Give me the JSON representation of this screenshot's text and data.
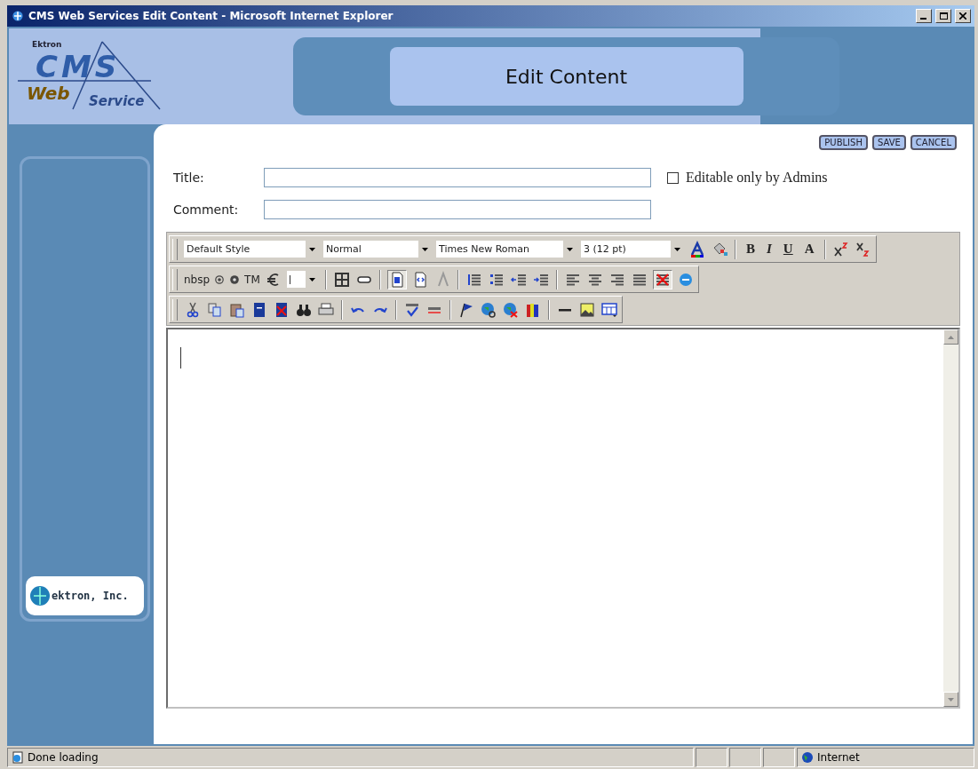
{
  "window": {
    "title": "CMS Web Services Edit Content - Microsoft Internet Explorer"
  },
  "logo": {
    "vendor": "Ektron",
    "product": "CMS",
    "line_1": "Web",
    "line_2": "Service"
  },
  "header": {
    "title": "Edit Content"
  },
  "sidebar": {
    "badge": "ektron, Inc."
  },
  "actions": [
    "PUBLISH",
    "SAVE",
    "CANCEL"
  ],
  "form": {
    "title_label": "Title:",
    "comment_label": "Comment:",
    "admin_only": {
      "label": "Editable only by Admins",
      "checked": false
    }
  },
  "toolbar": {
    "selects": [
      "Default Style",
      "Normal",
      "Times New Roman",
      "3 (12 pt)"
    ],
    "format_glyphs": [
      "B",
      "I",
      "U",
      "A"
    ],
    "entities": [
      "nbsp",
      "TM"
    ]
  },
  "status_bar": {
    "message": "Done loading",
    "zone": "Internet"
  }
}
